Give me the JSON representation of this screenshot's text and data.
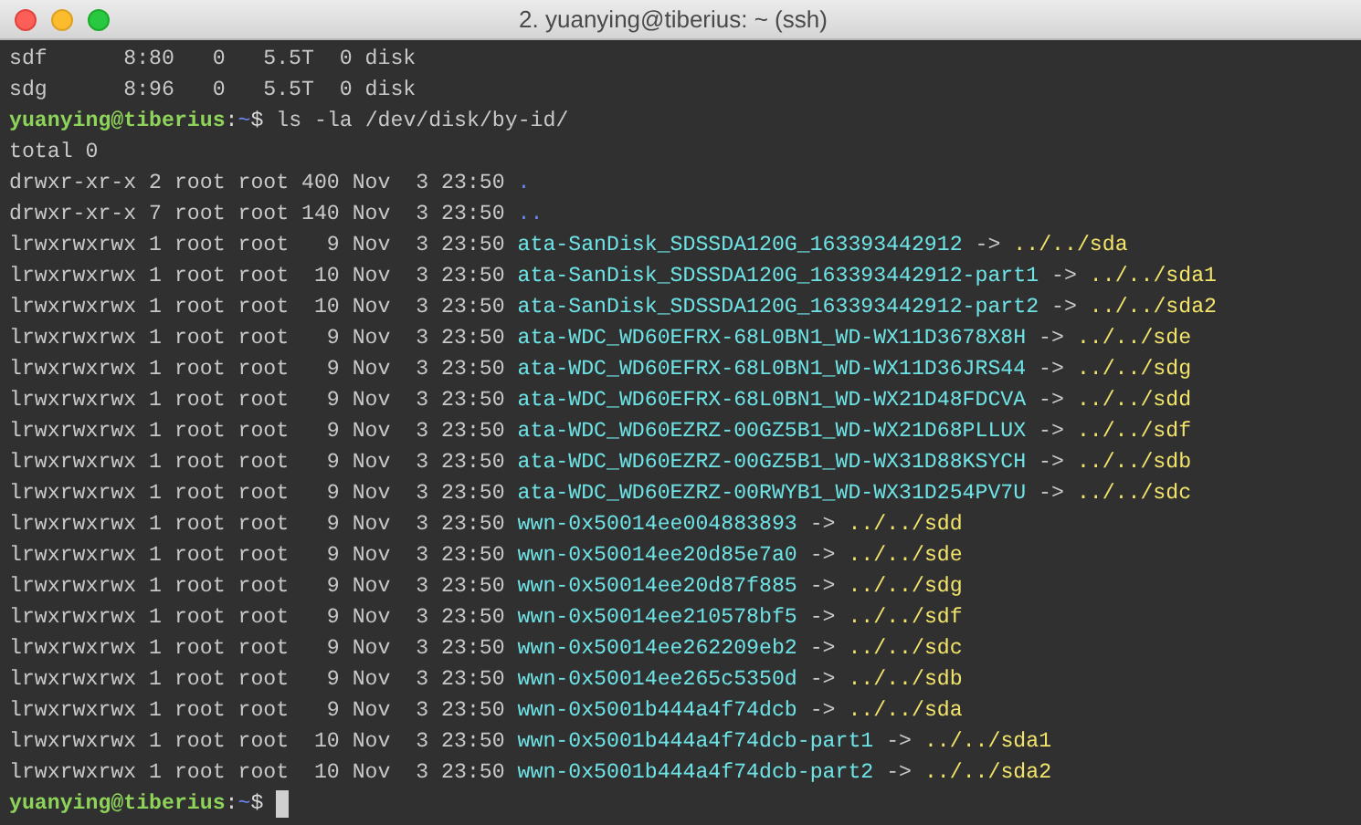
{
  "window": {
    "title": "2. yuanying@tiberius: ~ (ssh)"
  },
  "lines": [
    {
      "kind": "text",
      "text": "sdf      8:80   0   5.5T  0 disk"
    },
    {
      "kind": "text",
      "text": "sdg      8:96   0   5.5T  0 disk"
    },
    {
      "kind": "prompt",
      "user": "yuanying@tiberius",
      "sep": ":",
      "path": "~",
      "sign": "$",
      "command": " ls -la /dev/disk/by-id/"
    },
    {
      "kind": "text",
      "text": "total 0"
    },
    {
      "kind": "dir",
      "meta": "drwxr-xr-x 2 root root 400 Nov  3 23:50 ",
      "name": "."
    },
    {
      "kind": "dir",
      "meta": "drwxr-xr-x 7 root root 140 Nov  3 23:50 ",
      "name": ".."
    },
    {
      "kind": "link",
      "meta": "lrwxrwxrwx 1 root root   9 Nov  3 23:50 ",
      "name": "ata-SanDisk_SDSSDA120G_163393442912",
      "arrow": " -> ",
      "target": "../../sda"
    },
    {
      "kind": "link",
      "meta": "lrwxrwxrwx 1 root root  10 Nov  3 23:50 ",
      "name": "ata-SanDisk_SDSSDA120G_163393442912-part1",
      "arrow": " -> ",
      "target": "../../sda1"
    },
    {
      "kind": "link",
      "meta": "lrwxrwxrwx 1 root root  10 Nov  3 23:50 ",
      "name": "ata-SanDisk_SDSSDA120G_163393442912-part2",
      "arrow": " -> ",
      "target": "../../sda2"
    },
    {
      "kind": "link",
      "meta": "lrwxrwxrwx 1 root root   9 Nov  3 23:50 ",
      "name": "ata-WDC_WD60EFRX-68L0BN1_WD-WX11D3678X8H",
      "arrow": " -> ",
      "target": "../../sde"
    },
    {
      "kind": "link",
      "meta": "lrwxrwxrwx 1 root root   9 Nov  3 23:50 ",
      "name": "ata-WDC_WD60EFRX-68L0BN1_WD-WX11D36JRS44",
      "arrow": " -> ",
      "target": "../../sdg"
    },
    {
      "kind": "link",
      "meta": "lrwxrwxrwx 1 root root   9 Nov  3 23:50 ",
      "name": "ata-WDC_WD60EFRX-68L0BN1_WD-WX21D48FDCVA",
      "arrow": " -> ",
      "target": "../../sdd"
    },
    {
      "kind": "link",
      "meta": "lrwxrwxrwx 1 root root   9 Nov  3 23:50 ",
      "name": "ata-WDC_WD60EZRZ-00GZ5B1_WD-WX21D68PLLUX",
      "arrow": " -> ",
      "target": "../../sdf"
    },
    {
      "kind": "link",
      "meta": "lrwxrwxrwx 1 root root   9 Nov  3 23:50 ",
      "name": "ata-WDC_WD60EZRZ-00GZ5B1_WD-WX31D88KSYCH",
      "arrow": " -> ",
      "target": "../../sdb"
    },
    {
      "kind": "link",
      "meta": "lrwxrwxrwx 1 root root   9 Nov  3 23:50 ",
      "name": "ata-WDC_WD60EZRZ-00RWYB1_WD-WX31D254PV7U",
      "arrow": " -> ",
      "target": "../../sdc"
    },
    {
      "kind": "link",
      "meta": "lrwxrwxrwx 1 root root   9 Nov  3 23:50 ",
      "name": "wwn-0x50014ee004883893",
      "arrow": " -> ",
      "target": "../../sdd"
    },
    {
      "kind": "link",
      "meta": "lrwxrwxrwx 1 root root   9 Nov  3 23:50 ",
      "name": "wwn-0x50014ee20d85e7a0",
      "arrow": " -> ",
      "target": "../../sde"
    },
    {
      "kind": "link",
      "meta": "lrwxrwxrwx 1 root root   9 Nov  3 23:50 ",
      "name": "wwn-0x50014ee20d87f885",
      "arrow": " -> ",
      "target": "../../sdg"
    },
    {
      "kind": "link",
      "meta": "lrwxrwxrwx 1 root root   9 Nov  3 23:50 ",
      "name": "wwn-0x50014ee210578bf5",
      "arrow": " -> ",
      "target": "../../sdf"
    },
    {
      "kind": "link",
      "meta": "lrwxrwxrwx 1 root root   9 Nov  3 23:50 ",
      "name": "wwn-0x50014ee262209eb2",
      "arrow": " -> ",
      "target": "../../sdc"
    },
    {
      "kind": "link",
      "meta": "lrwxrwxrwx 1 root root   9 Nov  3 23:50 ",
      "name": "wwn-0x50014ee265c5350d",
      "arrow": " -> ",
      "target": "../../sdb"
    },
    {
      "kind": "link",
      "meta": "lrwxrwxrwx 1 root root   9 Nov  3 23:50 ",
      "name": "wwn-0x5001b444a4f74dcb",
      "arrow": " -> ",
      "target": "../../sda"
    },
    {
      "kind": "link",
      "meta": "lrwxrwxrwx 1 root root  10 Nov  3 23:50 ",
      "name": "wwn-0x5001b444a4f74dcb-part1",
      "arrow": " -> ",
      "target": "../../sda1"
    },
    {
      "kind": "link",
      "meta": "lrwxrwxrwx 1 root root  10 Nov  3 23:50 ",
      "name": "wwn-0x5001b444a4f74dcb-part2",
      "arrow": " -> ",
      "target": "../../sda2"
    },
    {
      "kind": "prompt",
      "user": "yuanying@tiberius",
      "sep": ":",
      "path": "~",
      "sign": "$",
      "cursor": true
    }
  ]
}
